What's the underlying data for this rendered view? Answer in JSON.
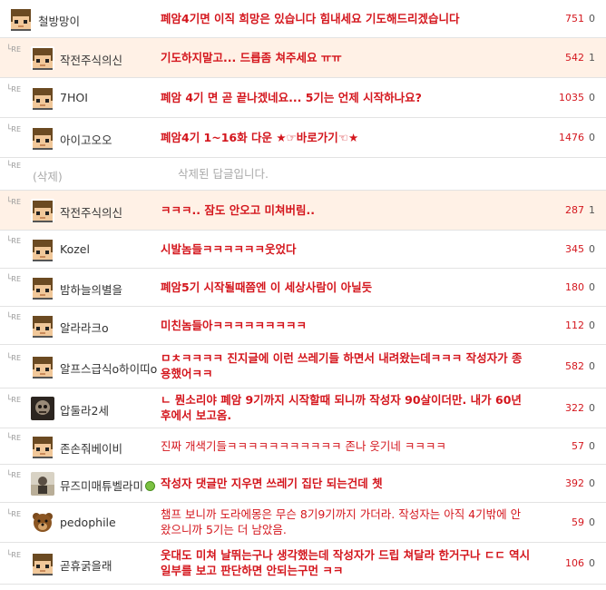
{
  "reply_tag": "RE",
  "deleted_num": "",
  "rows": [
    {
      "nick": "철방망이",
      "text": "폐암4기면 이직 희망은 있습니다 힘내세요 기도해드리겠습니다",
      "count": "751",
      "num": "0",
      "avatar": "pixel",
      "top": true,
      "h": 42,
      "weight": "bold"
    },
    {
      "nick": "작전주식의신",
      "text": "기도하지말고... 드릅좀 쳐주세요 ㅠㅠ",
      "count": "542",
      "num": "1",
      "avatar": "pixel",
      "hl": true,
      "h": 44,
      "weight": "bold"
    },
    {
      "nick": "7HOI",
      "text": "폐암 4기 면 곧 끝나겠네요... 5기는 언제 시작하나요?",
      "count": "1035",
      "num": "0",
      "avatar": "pixel",
      "h": 44,
      "weight": "bold"
    },
    {
      "nick": "아이고오오",
      "text": "폐암4기 1~16화 다운 ★☞바로가기☜★",
      "count": "1476",
      "num": "0",
      "avatar": "pixel",
      "h": 44,
      "weight": "bold"
    },
    {
      "nick": "(삭제)",
      "text": "삭제된 답글입니다.",
      "count": "",
      "num": "",
      "avatar": "none",
      "deleted": true,
      "h": 36
    },
    {
      "nick": "작전주식의신",
      "text": "ㅋㅋㅋ.. 잠도 안오고 미쳐버림..",
      "count": "287",
      "num": "1",
      "avatar": "pixel",
      "hl": true,
      "h": 44,
      "weight": "bold"
    },
    {
      "nick": "Kozel",
      "text": "시발놈들ㅋㅋㅋㅋㅋㅋ웃었다",
      "count": "345",
      "num": "0",
      "avatar": "pixel",
      "h": 42,
      "weight": "bold"
    },
    {
      "nick": "밤하늘의별을",
      "text": "폐암5기 시작될때쯤엔 이 세상사람이 아닐듯",
      "count": "180",
      "num": "0",
      "avatar": "pixel",
      "h": 42,
      "weight": "bold"
    },
    {
      "nick": "알라라크o",
      "text": "미친놈들아ㅋㅋㅋㅋㅋㅋㅋㅋㅋ",
      "count": "112",
      "num": "0",
      "avatar": "pixel",
      "h": 42,
      "weight": "bold"
    },
    {
      "nick": "알프스급식o하이띠o",
      "text": "ㅁㅊㅋㅋㅋㅋ 진지글에 이런 쓰레기들 하면서 내려왔는데ㅋㅋㅋ 작성자가 종용했어ㅋㅋ",
      "count": "582",
      "num": "0",
      "avatar": "pixel",
      "h": 48,
      "weight": "bold"
    },
    {
      "nick": "압둘라2세",
      "text": "ㄴ 뭔소리야 폐암 9기까지 시작할때 되니까 작성자 90살이더만. 내가 60년 후에서 보고옴.",
      "count": "322",
      "num": "0",
      "avatar": "dark",
      "h": 44,
      "weight": "bold"
    },
    {
      "nick": "존손줘베이비",
      "text": "진짜 개색기들ㅋㅋㅋㅋㅋㅋㅋㅋㅋㅋㅋ 존나 웃기네 ㅋㅋㅋㅋ",
      "count": "57",
      "num": "0",
      "avatar": "pixel",
      "h": 40,
      "weight": "light"
    },
    {
      "nick": "뮤즈미매튜벨라미",
      "text": "작성자 댓글만 지우면 쓰레기 집단 되는건데 쳇",
      "count": "392",
      "num": "0",
      "avatar": "photo",
      "online": true,
      "h": 42,
      "weight": "bold"
    },
    {
      "nick": "pedophile",
      "text": "챔프 보니까 도라에몽은 무슨 8기9기까지 가더라. 작성자는 아직 4기밖에 안왔으니까 5기는 더 남았음.",
      "count": "59",
      "num": "0",
      "avatar": "bear",
      "h": 44,
      "weight": "light"
    },
    {
      "nick": "곧휴굵을래",
      "text": "웃대도 미쳐 날뛰는구나 생각했는데 작성자가 드립 쳐달라 한거구나 ㄷㄷ 역시 일부를 보고 판단하면 안되는구먼 ㅋㅋ",
      "count": "106",
      "num": "0",
      "avatar": "pixel",
      "h": 46,
      "weight": "bold"
    }
  ]
}
